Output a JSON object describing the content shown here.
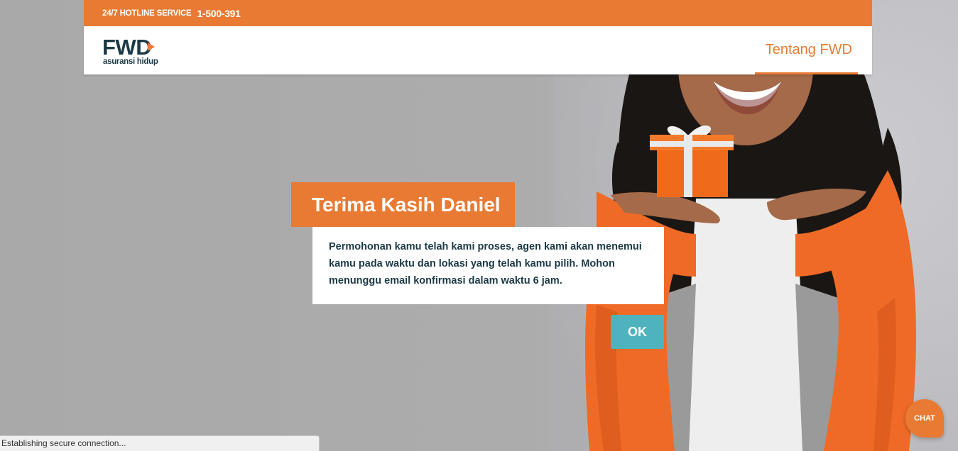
{
  "header": {
    "hotline_label": "24/7 HOTLINE SERVICE",
    "hotline_number": "1-500-391",
    "logo_text": "FWD",
    "logo_subtitle": "asuransi hidup",
    "nav_link": "Tentang FWD"
  },
  "modal": {
    "title": "Terima Kasih Daniel",
    "message": "Permohonan kamu telah kami proses, agen kami akan menemui kamu pada waktu dan lokasi yang telah kamu pilih. Mohon menunggu email konfirmasi dalam waktu 6 jam.",
    "ok_label": "OK"
  },
  "chat": {
    "label": "CHAT"
  },
  "status_bar": {
    "text": "Establishing secure connection..."
  },
  "colors": {
    "brand_orange": "#e87a33",
    "brand_navy": "#1c3a45",
    "button_teal": "#4fb3bd"
  }
}
